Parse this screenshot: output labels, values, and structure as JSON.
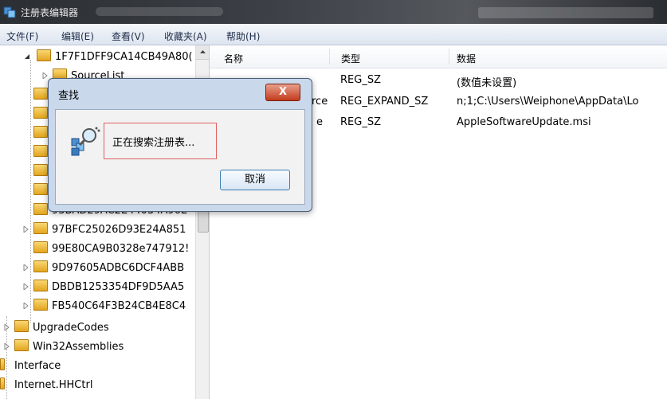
{
  "window": {
    "title": "注册表编辑器"
  },
  "menu": [
    "文件(F)",
    "编辑(E)",
    "查看(V)",
    "收藏夹(A)",
    "帮助(H)"
  ],
  "tree": {
    "top_key": "1F7F1DFF9CA14CB49A80(",
    "sub_key": "SourceList",
    "partial_key": "93BAD29AC2E44034A96E",
    "keys": [
      "97BFC25026D93E24A851",
      "99E80CA9B0328e747912!",
      "9D97605ADBC6DCF4ABB",
      "DBDB1253354DF9D5AA5",
      "FB540C64F3B24CB4E8C4"
    ],
    "parent_keys": [
      "UpgradeCodes",
      "Win32Assemblies"
    ],
    "root_keys": [
      "Interface",
      "Internet.HHCtrl"
    ]
  },
  "list": {
    "columns": {
      "name": "名称",
      "type": "类型",
      "data": "数据"
    },
    "rows": [
      {
        "name": "",
        "type": "REG_SZ",
        "data": "(数值未设置)"
      },
      {
        "name": "rce",
        "type": "REG_EXPAND_SZ",
        "data": "n;1;C:\\Users\\Weiphone\\AppData\\Lo"
      },
      {
        "name": "e",
        "type": "REG_SZ",
        "data": "AppleSoftwareUpdate.msi"
      }
    ]
  },
  "dialog": {
    "title": "查找",
    "close_label": "X",
    "message": "正在搜索注册表...",
    "cancel_label": "取消"
  }
}
